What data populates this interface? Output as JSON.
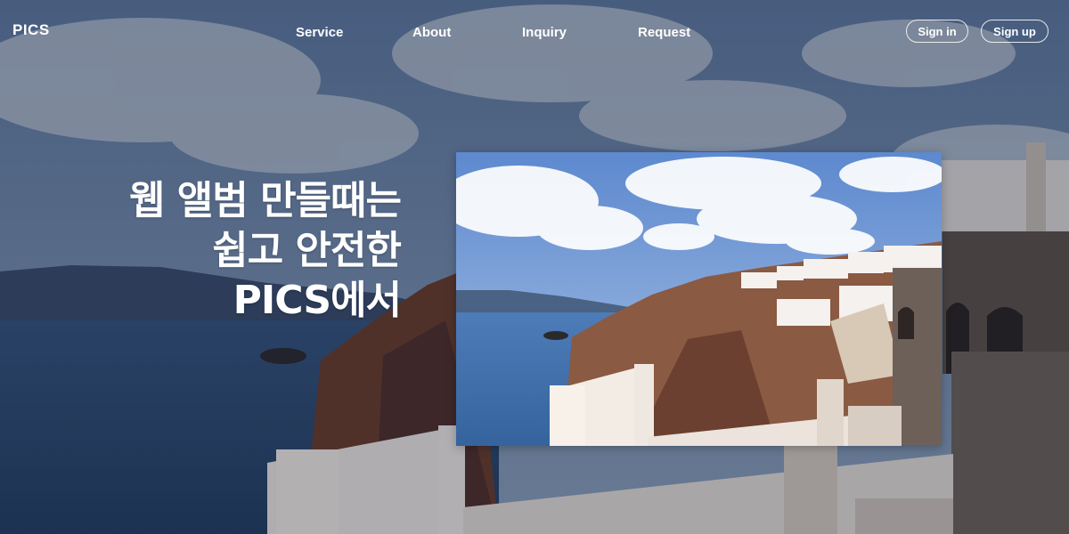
{
  "brand": {
    "logo": "PICS"
  },
  "nav": {
    "items": [
      {
        "label": "Service"
      },
      {
        "label": "About"
      },
      {
        "label": "Inquiry"
      },
      {
        "label": "Request"
      }
    ]
  },
  "auth": {
    "sign_in": "Sign in",
    "sign_up": "Sign up"
  },
  "hero": {
    "lines": [
      "웹 앨범 만들때는",
      "쉽고 안전한",
      "PICS에서"
    ],
    "image": "santorini-cliffs-photo"
  },
  "colors": {
    "sky": "#6d8fc0",
    "sea": "#2f5a91",
    "cliff": "#6a3e2c",
    "wall": "#e9e3dd",
    "text": "#ffffff"
  }
}
